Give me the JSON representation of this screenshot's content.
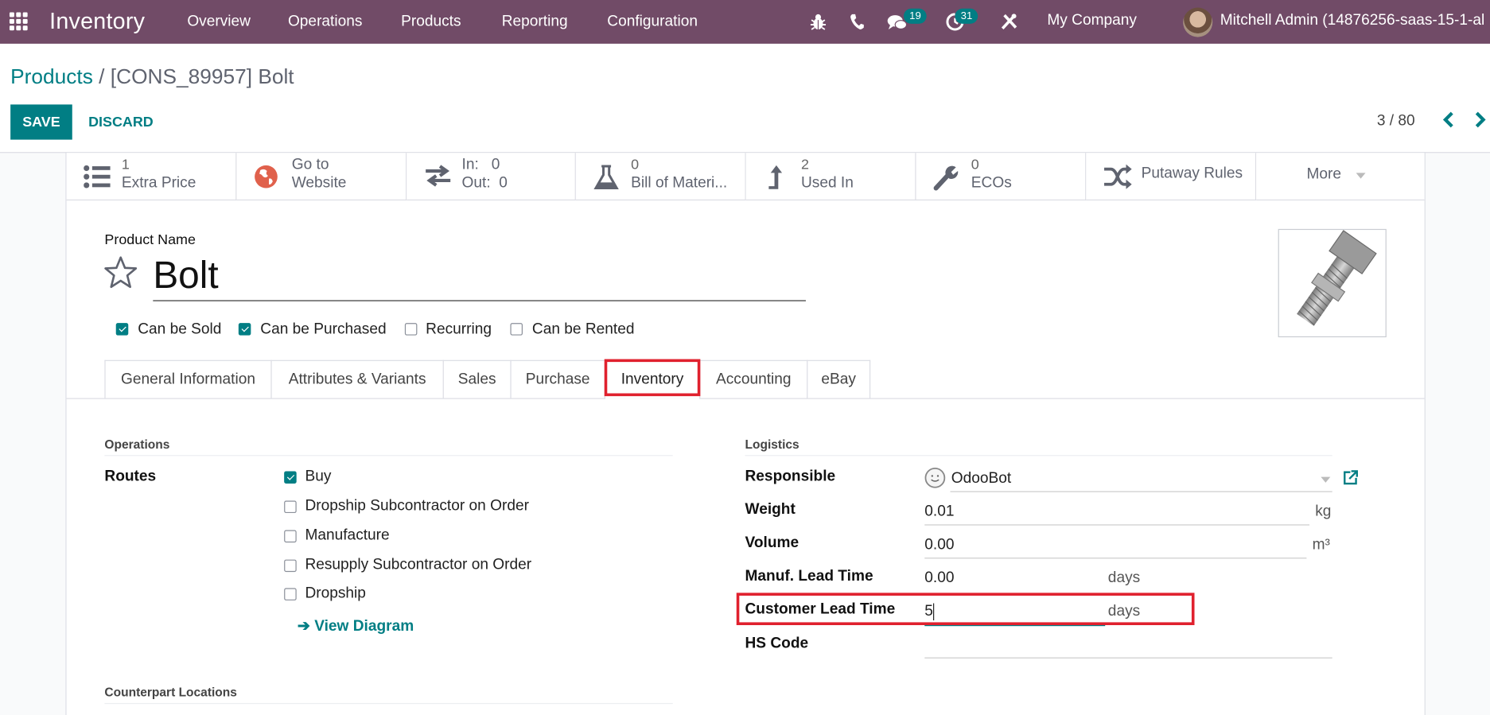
{
  "navbar": {
    "app_title": "Inventory",
    "menu": [
      "Overview",
      "Operations",
      "Products",
      "Reporting",
      "Configuration"
    ],
    "icons": [
      "bug-icon",
      "phone-icon",
      "chat-icon",
      "activity-clock-icon",
      "tools-icon"
    ],
    "messages_badge": "19",
    "activities_badge": "31",
    "company": "My Company",
    "user": "Mitchell Admin (14876256-saas-15-1-al"
  },
  "breadcrumb": {
    "root": "Products",
    "separator": "/",
    "current": "[CONS_89957] Bolt"
  },
  "actions": {
    "save": "SAVE",
    "discard": "DISCARD"
  },
  "pager": {
    "value": "3 / 80"
  },
  "smart_buttons": [
    {
      "icon": "list-icon",
      "value": "1",
      "label": "Extra Price"
    },
    {
      "icon": "globe-icon",
      "value": "Go to",
      "label": "Website"
    },
    {
      "icon": "exchange-icon",
      "value": "In:   0",
      "label": "Out:  0"
    },
    {
      "icon": "flask-icon",
      "value": "0",
      "label": "Bill of Materi..."
    },
    {
      "icon": "level-up-icon",
      "value": "2",
      "label": "Used In"
    },
    {
      "icon": "wrench-icon",
      "value": "0",
      "label": "ECOs"
    },
    {
      "icon": "shuffle-icon",
      "value": "",
      "label": "Putaway Rules"
    },
    {
      "icon": "caret-down-icon",
      "value": "",
      "label": "More"
    }
  ],
  "product": {
    "name_label": "Product Name",
    "name": "Bolt",
    "flags": [
      {
        "label": "Can be Sold",
        "checked": true
      },
      {
        "label": "Can be Purchased",
        "checked": true
      },
      {
        "label": "Recurring",
        "checked": false
      },
      {
        "label": "Can be Rented",
        "checked": false
      }
    ]
  },
  "tabs": [
    {
      "label": "General Information",
      "active": false
    },
    {
      "label": "Attributes & Variants",
      "active": false
    },
    {
      "label": "Sales",
      "active": false
    },
    {
      "label": "Purchase",
      "active": false
    },
    {
      "label": "Inventory",
      "active": true
    },
    {
      "label": "Accounting",
      "active": false
    },
    {
      "label": "eBay",
      "active": false
    }
  ],
  "operations": {
    "title": "Operations",
    "routes_label": "Routes",
    "routes": [
      {
        "label": "Buy",
        "checked": true
      },
      {
        "label": "Dropship Subcontractor on Order",
        "checked": false
      },
      {
        "label": "Manufacture",
        "checked": false
      },
      {
        "label": "Resupply Subcontractor on Order",
        "checked": false
      },
      {
        "label": "Dropship",
        "checked": false
      }
    ],
    "view_diagram": "View Diagram"
  },
  "logistics": {
    "title": "Logistics",
    "responsible": {
      "label": "Responsible",
      "value": "OdooBot"
    },
    "weight": {
      "label": "Weight",
      "value": "0.01",
      "unit": "kg"
    },
    "volume": {
      "label": "Volume",
      "value": "0.00",
      "unit": "m³"
    },
    "manuf_lead_time": {
      "label": "Manuf. Lead Time",
      "value": "0.00",
      "unit": "days"
    },
    "customer_lead_time": {
      "label": "Customer Lead Time",
      "value": "5",
      "unit": "days"
    },
    "hs_code": {
      "label": "HS Code",
      "value": ""
    }
  },
  "counterpart": {
    "title": "Counterpart Locations"
  },
  "colors": {
    "brand": "#714B67",
    "accent": "#017e84",
    "highlight": "#e0212e"
  }
}
